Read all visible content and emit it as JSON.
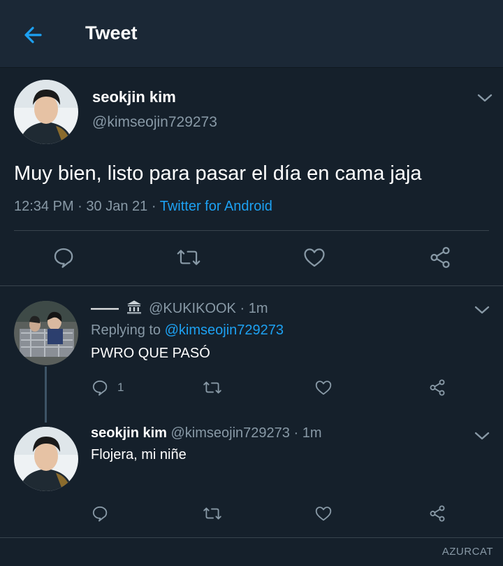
{
  "header": {
    "title": "Tweet"
  },
  "main_tweet": {
    "display_name": "seokjin kim",
    "handle": "@kimseojin729273",
    "text": "Muy bien, listo para pasar el día en cama jaja",
    "time": "12:34 PM",
    "date": "30 Jan 21",
    "source": "Twitter for Android",
    "separator": "·"
  },
  "replies": [
    {
      "display_name": "——",
      "handle": "@KUKIKOOK",
      "time": "1m",
      "replying_label": "Replying to",
      "replying_to": "@kimseojin729273",
      "text": "PWRO QUE PASÓ",
      "reply_count": "1"
    },
    {
      "display_name": "seokjin kim",
      "handle": "@kimseojin729273",
      "time": "1m",
      "text": "Flojera, mi niñe"
    }
  ],
  "watermark": "AZURCAT",
  "colors": {
    "background": "#15202b",
    "header": "#1b2836",
    "accent": "#1da1f2",
    "muted": "#8899a6",
    "divider": "#38444d"
  },
  "icons": [
    "back-arrow-icon",
    "chevron-down-icon",
    "reply-icon",
    "retweet-icon",
    "like-icon",
    "share-icon",
    "bank-icon"
  ]
}
